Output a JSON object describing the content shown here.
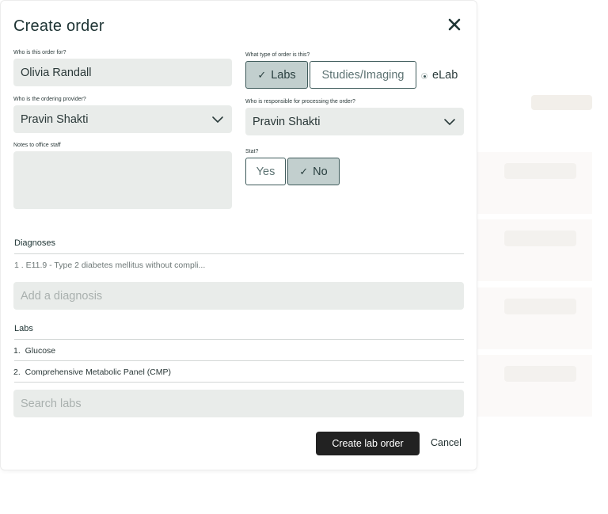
{
  "dialog": {
    "title": "Create order"
  },
  "patient": {
    "label": "Who is this order for?",
    "value": "Olivia Randall"
  },
  "order_type": {
    "label": "What type of order is this?",
    "options": [
      "Labs",
      "Studies/Imaging"
    ],
    "selected": "Labs",
    "radio_label": "eLab"
  },
  "ordering_provider": {
    "label": "Who is the ordering provider?",
    "value": "Pravin Shakti"
  },
  "processing": {
    "label": "Who is responsible for processing the order?",
    "value": "Pravin Shakti"
  },
  "notes": {
    "label": "Notes to office staff",
    "value": ""
  },
  "stat": {
    "label": "Stat?",
    "options": [
      "Yes",
      "No"
    ],
    "selected": "No"
  },
  "diagnoses": {
    "heading": "Diagnoses",
    "items": [
      {
        "index": "1 .",
        "text": "E11.9 - Type 2 diabetes mellitus without compli..."
      }
    ],
    "placeholder": "Add a diagnosis"
  },
  "labs": {
    "heading": "Labs",
    "items": [
      {
        "index": "1.",
        "text": "Glucose"
      },
      {
        "index": "2.",
        "text": "Comprehensive Metabolic Panel (CMP)"
      }
    ],
    "placeholder": "Search labs"
  },
  "actions": {
    "primary": "Create lab order",
    "cancel": "Cancel"
  },
  "icons": {
    "close": "close-icon",
    "chevron": "chevron-down-icon",
    "check": "check-icon"
  },
  "colors": {
    "field_bg": "#e9ecea",
    "segment_active": "#c2cfce",
    "primary_button": "#222222"
  }
}
